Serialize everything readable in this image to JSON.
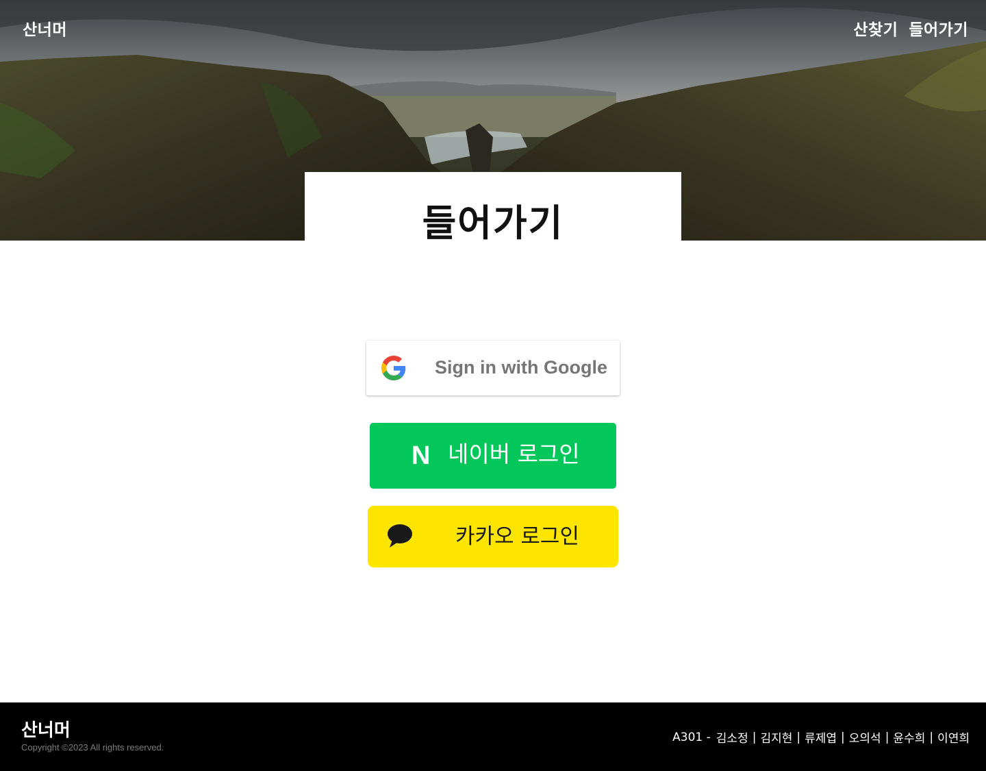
{
  "header": {
    "brand": "산너머",
    "nav": [
      {
        "label": "산찾기"
      },
      {
        "label": "들어가기"
      }
    ]
  },
  "page": {
    "title": "들어가기"
  },
  "login": {
    "google_label": "Sign in with Google",
    "naver_label": "네이버 로그인",
    "naver_icon_letter": "N",
    "kakao_label": "카카오 로그인"
  },
  "colors": {
    "naver": "#03c75a",
    "kakao": "#fee500",
    "footer_bg": "#000000"
  },
  "footer": {
    "brand": "산너머",
    "copyright": "Copyright ©2023 All rights reserved.",
    "team_prefix": "A301 -",
    "members": [
      "김소정",
      "김지현",
      "류제엽",
      "오의석",
      "윤수희",
      "이연희"
    ]
  }
}
